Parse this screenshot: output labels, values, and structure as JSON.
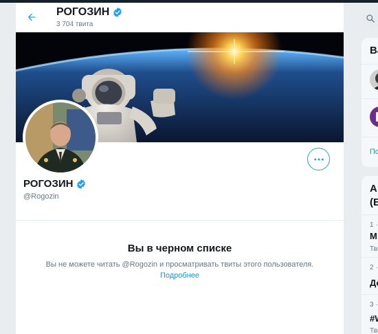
{
  "header": {
    "title": "РОГОЗИН",
    "tweet_count": "3 704 твита"
  },
  "profile": {
    "name": "РОГОЗИН",
    "handle": "@Rogozin"
  },
  "blocked": {
    "title": "Вы в черном списке",
    "text": "Вы не можете читать @Rogozin и просматривать твиты этого пользователя.",
    "link": "Подробнее"
  },
  "sidebar": {
    "card1": {
      "title_fragment": "Ва",
      "link_fragment": "По"
    },
    "card2": {
      "title_fragment_1": "А",
      "title_fragment_2": "(Е",
      "trends": [
        {
          "rank": "1 ·",
          "name": "М",
          "count": "Тви"
        },
        {
          "rank": "2 ·",
          "name": "До",
          "count": ""
        },
        {
          "rank": "3 ·",
          "name": "#W",
          "count": "Тви"
        }
      ]
    }
  },
  "colors": {
    "accent": "#1da1f2",
    "verified": "#1da1f2",
    "secondary_text": "#657786",
    "link": "#1b95e0",
    "top_bar": "#15202b"
  },
  "icons": {
    "back": "arrow-left-icon",
    "verified": "verified-badge-icon",
    "more": "more-horizontal-icon",
    "search": "search-icon"
  }
}
